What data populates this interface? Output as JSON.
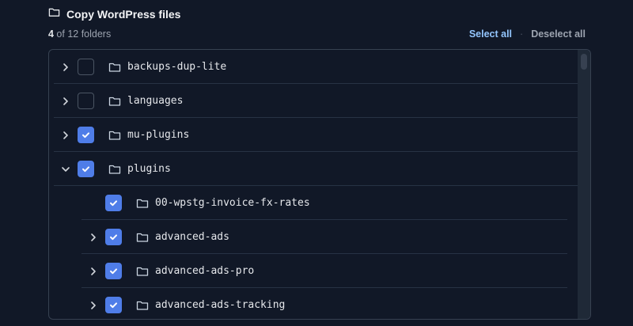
{
  "header": {
    "title": "Copy WordPress files",
    "icon": "folder-icon"
  },
  "summary": {
    "selected": "4",
    "rest": " of 12 folders"
  },
  "actions": {
    "select_all": "Select all",
    "separator": "·",
    "deselect_all": "Deselect all"
  },
  "tree": [
    {
      "name": "backups-dup-lite",
      "checked": false,
      "expanded": false,
      "level": 0,
      "has_children": true
    },
    {
      "name": "languages",
      "checked": false,
      "expanded": false,
      "level": 0,
      "has_children": true
    },
    {
      "name": "mu-plugins",
      "checked": true,
      "expanded": false,
      "level": 0,
      "has_children": true
    },
    {
      "name": "plugins",
      "checked": true,
      "expanded": true,
      "level": 0,
      "has_children": true
    },
    {
      "name": "00-wpstg-invoice-fx-rates",
      "checked": true,
      "expanded": false,
      "level": 1,
      "has_children": false
    },
    {
      "name": "advanced-ads",
      "checked": true,
      "expanded": false,
      "level": 1,
      "has_children": true
    },
    {
      "name": "advanced-ads-pro",
      "checked": true,
      "expanded": false,
      "level": 1,
      "has_children": true
    },
    {
      "name": "advanced-ads-tracking",
      "checked": true,
      "expanded": false,
      "level": 1,
      "has_children": true
    }
  ],
  "colors": {
    "accent": "#4f7de8",
    "link": "#93c5fd",
    "background": "#111827",
    "border": "#374151"
  }
}
